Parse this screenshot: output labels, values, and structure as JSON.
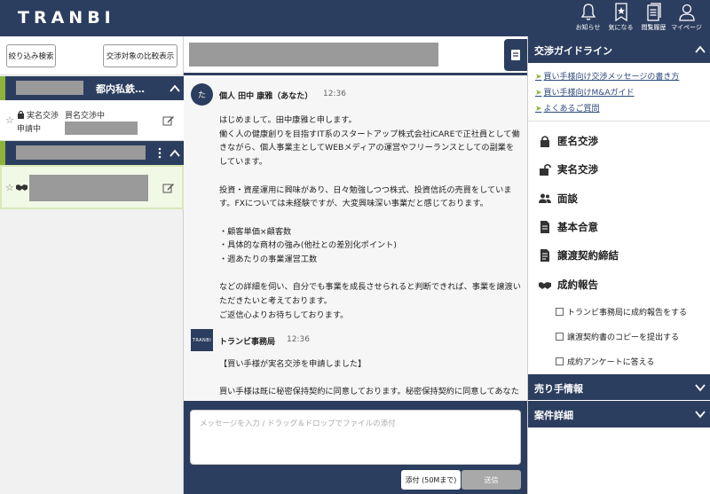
{
  "header": {
    "logo": "TRANBI",
    "nav": [
      {
        "label": "お知らせ",
        "icon": "bell-icon"
      },
      {
        "label": "気になる",
        "icon": "bookmark-star-icon"
      },
      {
        "label": "閲覧履歴",
        "icon": "history-document-icon"
      },
      {
        "label": "マイページ",
        "icon": "user-icon"
      }
    ]
  },
  "sidebar": {
    "filter_button": "絞り込み検索",
    "compare_button": "交渉対象の比較表示",
    "group1": {
      "title": "都内私鉄…"
    },
    "item1": {
      "status_line1": "実名交渉",
      "status_line2": "申請中",
      "status_detail": "買名交渉中"
    },
    "colors": {
      "header": "#2c3e5f",
      "accent": "#8db33a",
      "selected_bg": "#f2f8e6"
    }
  },
  "chat": {
    "messages": [
      {
        "avatar": "た",
        "sender": "個人 田中 康雅（あなた）",
        "time": "12:36",
        "paragraphs": [
          "はじめまして。田中康雅と申します。\n働く人の健康創りを目指すIT系のスタートアップ株式会社iCAREで正社員として働きながら、個人事業主としてWEBメディアの運営やフリーランスとしての副業をしています。",
          "投資・資産運用に興味があり、日々勉強しつつ株式、投資信託の売買をしています。FXについては未経験ですが、大変興味深い事業だと感じております。",
          "・顧客単価×顧客数\n・具体的な商材の強み(他社との差別化ポイント)\n・週あたりの事業運営工数",
          "などの詳細を伺い、自分でも事業を成長させられると判断できれば、事業を譲渡いただきたいと考えております。\nご返信心よりお待ちしております。"
        ]
      },
      {
        "avatar": "TRANBI",
        "sender": "トランビ事務局",
        "time": "12:36",
        "paragraphs": [
          "【買い手様が実名交渉を申請しました】",
          "買い手様は既に秘密保持契約に同意しております。秘密保持契約に同意してあなたの情報を買い手様に開示しますか？"
        ]
      }
    ],
    "composer": {
      "placeholder": "メッセージを入力 / ドラッグ＆ドロップでファイルの添付",
      "attach_label": "添付 (50Mまで)",
      "send_label": "送信"
    }
  },
  "right_panel": {
    "guideline_title": "交渉ガイドライン",
    "links": [
      "買い手様向け交渉メッセージの書き方",
      "買い手様向けM&Aガイド",
      "よくあるご質問"
    ],
    "steps": [
      {
        "label": "匿名交渉",
        "icon": "lock-icon"
      },
      {
        "label": "実名交渉",
        "icon": "unlock-icon"
      },
      {
        "label": "面談",
        "icon": "people-icon"
      },
      {
        "label": "基本合意",
        "icon": "document-icon"
      },
      {
        "label": "譲渡契約締結",
        "icon": "contract-icon"
      },
      {
        "label": "成約報告",
        "icon": "handshake-icon"
      }
    ],
    "tasks": [
      "トランビ事務局に成約報告をする",
      "譲渡契約書のコピーを提出する",
      "成約アンケートに答える"
    ],
    "seller_info": "売り手情報",
    "deal_detail": "案件詳細"
  }
}
